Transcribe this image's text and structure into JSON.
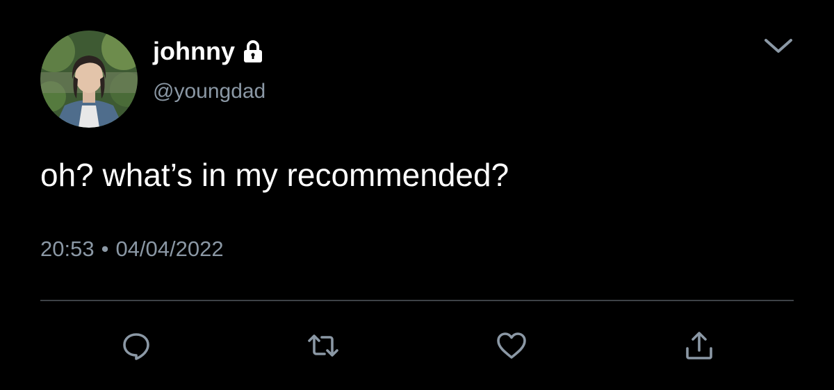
{
  "author": {
    "display_name": "johnny",
    "handle": "@youngdad",
    "protected_icon": "lock-icon",
    "avatar": "profile-photo"
  },
  "tweet": {
    "text": "oh? what’s in my recommended?",
    "time": "20:53",
    "separator": "•",
    "date": "04/04/2022"
  },
  "actions": [
    {
      "icon": "reply-icon"
    },
    {
      "icon": "retweet-icon"
    },
    {
      "icon": "like-icon"
    },
    {
      "icon": "share-icon"
    }
  ],
  "menu": {
    "icon": "chevron-down-icon"
  },
  "colors": {
    "background": "#000000",
    "primary_text": "#ffffff",
    "secondary_text": "#8b98a5",
    "divider": "#3d4247"
  }
}
